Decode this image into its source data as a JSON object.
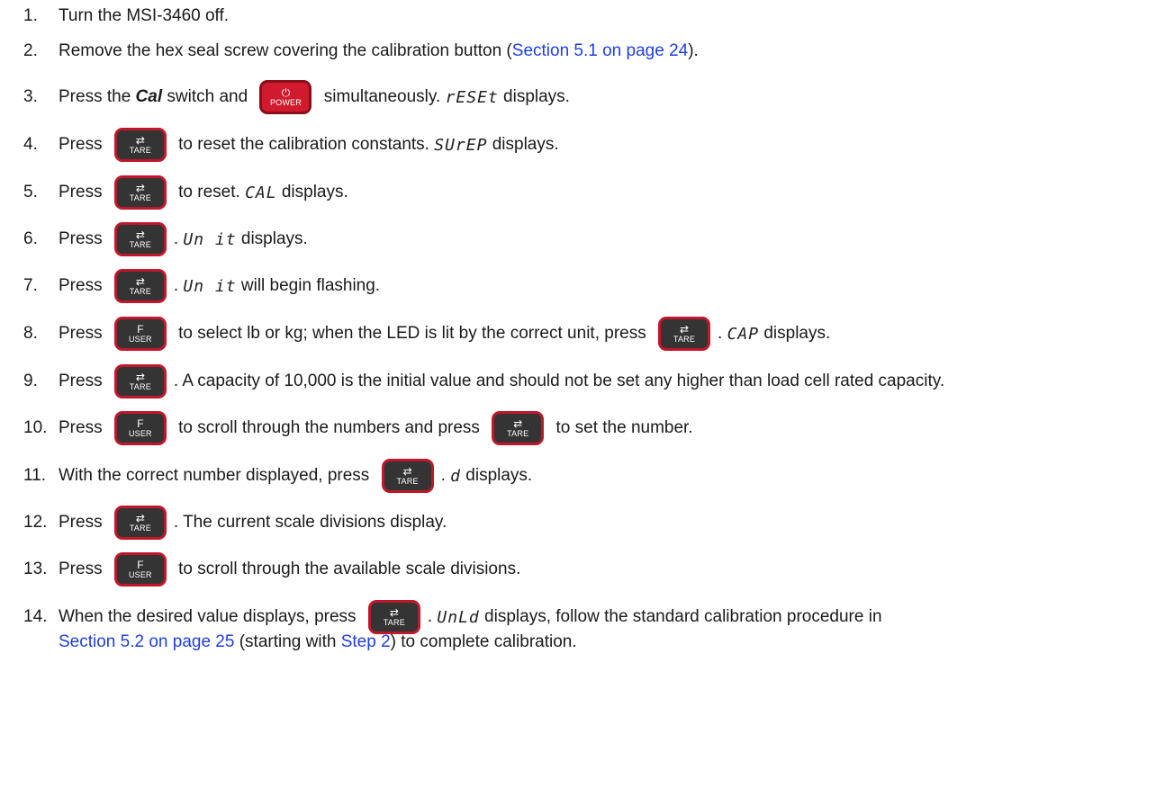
{
  "keys": {
    "power": {
      "glyph": "⏻",
      "label": "POWER"
    },
    "tare": {
      "glyph": "⇄",
      "label": "TARE"
    },
    "user": {
      "glyph": "F",
      "label": "USER"
    }
  },
  "steps": {
    "s1": {
      "num": "1.",
      "text": "Turn the MSI-3460 off."
    },
    "s2": {
      "num": "2.",
      "a": "Remove the hex seal screw covering the calibration button (",
      "link": "Section 5.1 on page 24",
      "b": ")."
    },
    "s3": {
      "num": "3.",
      "a": "Press the ",
      "cal": "Cal",
      "b": " switch and ",
      "c": " simultaneously. ",
      "lcd": "rESEt",
      "d": " displays."
    },
    "s4": {
      "num": "4.",
      "a": "Press ",
      "b": " to reset the calibration constants. ",
      "lcd": "SUrEP",
      "c": " displays."
    },
    "s5": {
      "num": "5.",
      "a": "Press ",
      "b": " to reset. ",
      "lcd": "CAL",
      "c": " displays."
    },
    "s6": {
      "num": "6.",
      "a": "Press ",
      "b": ". ",
      "lcd": "Un it",
      "c": " displays."
    },
    "s7": {
      "num": "7.",
      "a": "Press ",
      "b": ". ",
      "lcd": "Un it",
      "c": " will begin flashing."
    },
    "s8": {
      "num": "8.",
      "a": "Press ",
      "b": " to select lb or kg; when the LED is lit by the correct unit, press ",
      "c": ". ",
      "lcd": "CAP",
      "d": " displays."
    },
    "s9": {
      "num": "9.",
      "a": "Press ",
      "b": ". A capacity of 10,000 is the initial value and should not be set any higher than load cell rated capacity."
    },
    "s10": {
      "num": "10.",
      "a": "Press ",
      "b": " to scroll through the numbers and press ",
      "c": " to set the number."
    },
    "s11": {
      "num": "11.",
      "a": "With the correct number displayed, press ",
      "b": ". ",
      "lcd": "d",
      "c": " displays."
    },
    "s12": {
      "num": "12.",
      "a": "Press ",
      "b": ". The current scale divisions display."
    },
    "s13": {
      "num": "13.",
      "a": "Press ",
      "b": " to scroll through the available scale divisions."
    },
    "s14": {
      "num": "14.",
      "a": "When the desired value displays, press ",
      "b": ". ",
      "lcd": "UnLd",
      "c": " displays, follow the standard calibration procedure in",
      "link1": "Section 5.2 on page 25",
      "d": " (starting with ",
      "link2": "Step 2",
      "e": ") to complete calibration."
    }
  }
}
